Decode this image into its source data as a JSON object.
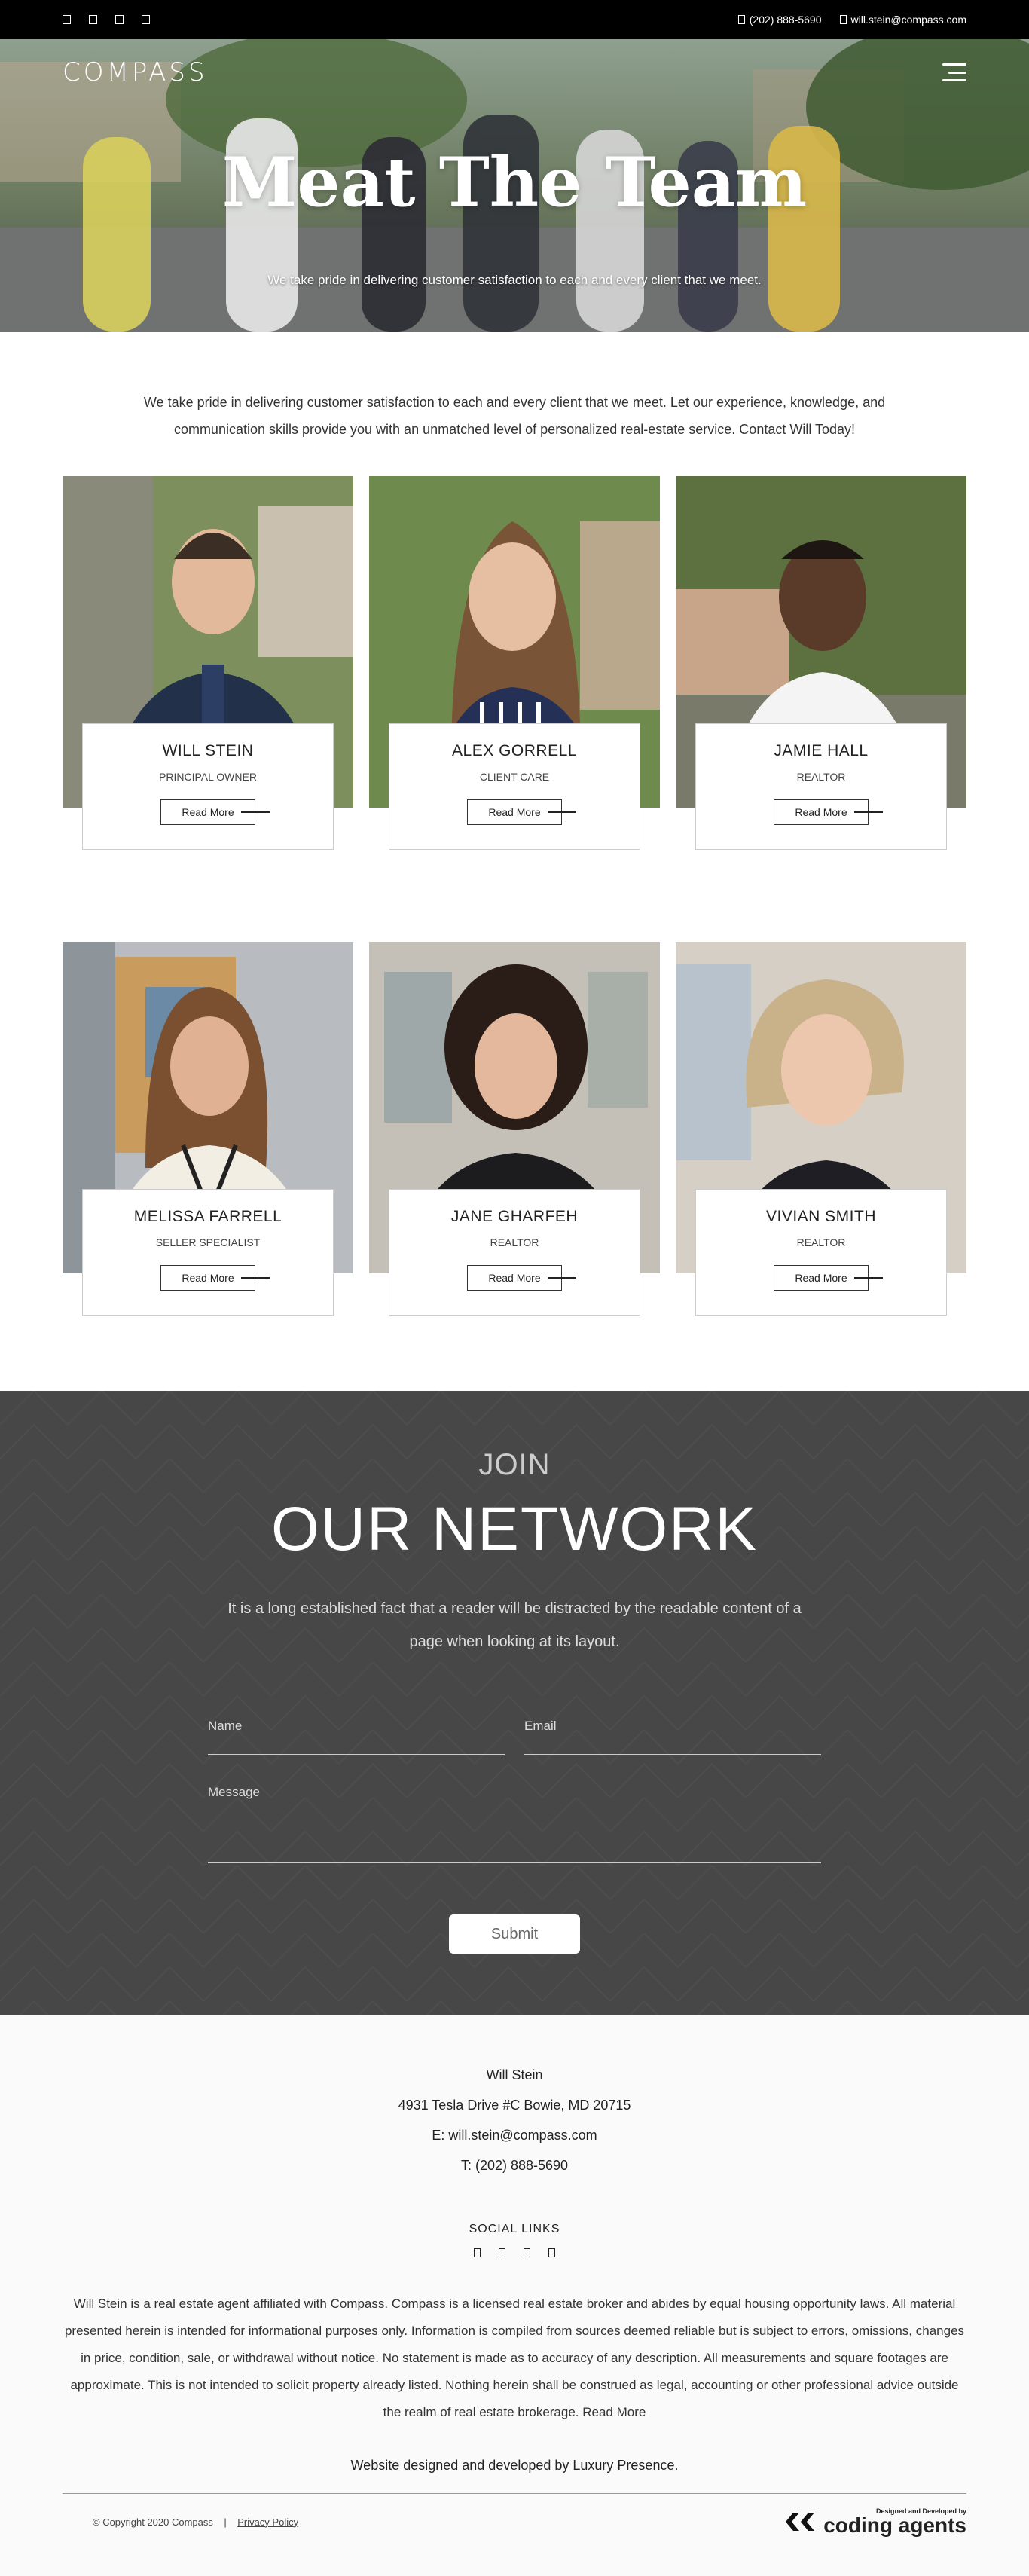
{
  "topbar": {
    "social_icons": [
      "facebook-icon",
      "twitter-icon",
      "instagram-icon",
      "linkedin-icon"
    ],
    "phone": "(202) 888-5690",
    "email": "will.stein@compass.com"
  },
  "hero": {
    "logo": "COMPASS",
    "title": "Meat The Team",
    "subtitle": "We take pride in delivering customer satisfaction to each and every client that we meet."
  },
  "intro": "We take pride in delivering customer satisfaction to each and every client that we meet. Let our experience, knowledge, and communication skills provide you with an unmatched level of personalized real-estate service. Contact Will Today!",
  "team": [
    {
      "name": "WILL STEIN",
      "role": "PRINCIPAL OWNER",
      "more": "Read More"
    },
    {
      "name": "ALEX GORRELL",
      "role": "CLIENT CARE",
      "more": "Read More"
    },
    {
      "name": "JAMIE HALL",
      "role": "REALTOR",
      "more": "Read More"
    },
    {
      "name": "MELISSA FARRELL",
      "role": "SELLER SPECIALIST",
      "more": "Read More"
    },
    {
      "name": "JANE GHARFEH",
      "role": "REALTOR",
      "more": "Read More"
    },
    {
      "name": "VIVIAN SMITH",
      "role": "REALTOR",
      "more": "Read More"
    }
  ],
  "join": {
    "kicker": "JOIN",
    "title": "OUR NETWORK",
    "description": "It is a long established fact that a reader will be distracted by the readable content of a page when looking at its layout.",
    "name_placeholder": "Name",
    "email_placeholder": "Email",
    "message_placeholder": "Message",
    "submit": "Submit"
  },
  "footer": {
    "name": "Will Stein",
    "address": "4931 Tesla Drive #C Bowie, MD 20715",
    "email": "E: will.stein@compass.com",
    "phone": "T: (202) 888-5690",
    "social_title": "SOCIAL LINKS",
    "disclaimer": "Will Stein is a real estate agent affiliated with Compass. Compass is a licensed real estate broker and abides by equal housing opportunity laws. All material presented herein is intended for informational purposes only. Information is compiled from sources deemed reliable but is subject to errors, omissions, changes in price, condition, sale, or withdrawal without notice. No statement is made as to accuracy of any description. All measurements and square footages are approximate. This is not intended to solicit property already listed. Nothing herein shall be construed as legal, accounting or other professional advice outside the realm of real estate brokerage. Read More",
    "credit": "Website designed and developed by Luxury Presence.",
    "copyright": "© Copyright 2020 Compass",
    "separator": "|",
    "privacy": "Privacy Policy",
    "brand_tagline": "Designed and Developed by",
    "brand_name": "coding agents"
  },
  "colors": {
    "topbar_bg": "#000000",
    "join_bg": "#474747",
    "footer_bg": "#fafafa"
  }
}
